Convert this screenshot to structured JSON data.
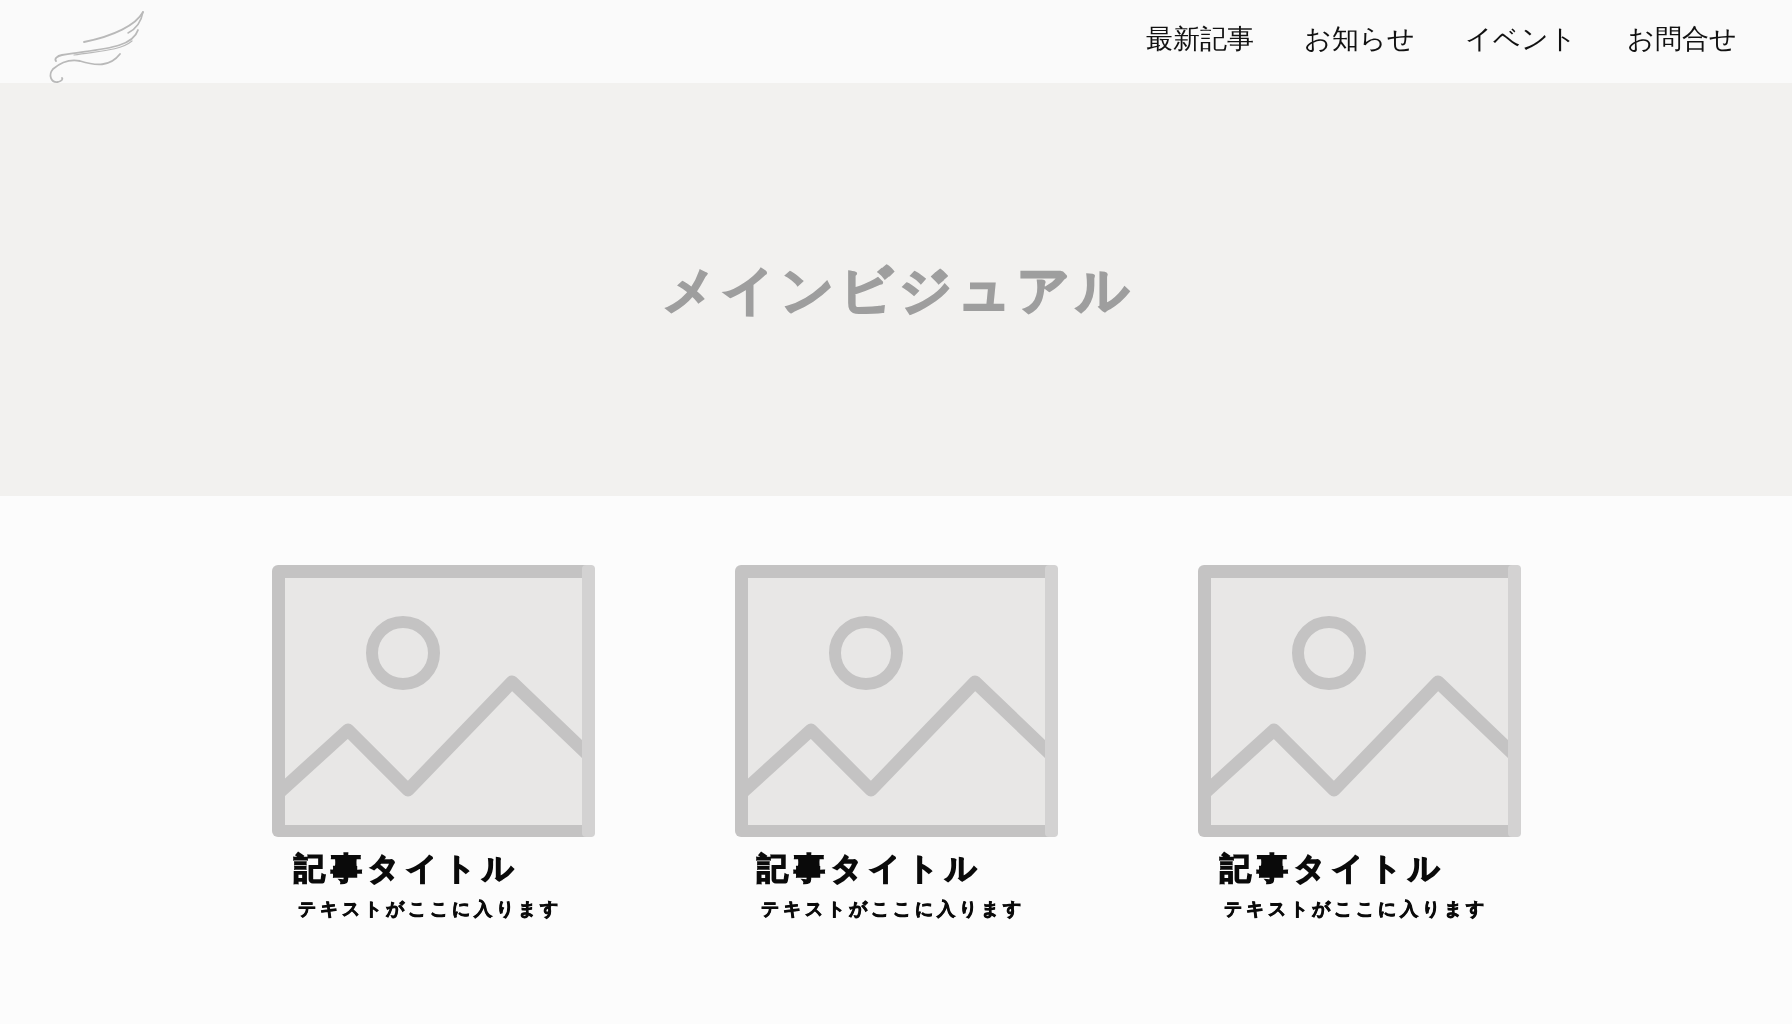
{
  "header": {
    "nav": [
      "最新記事",
      "お知らせ",
      "イベント",
      "お問合せ"
    ]
  },
  "hero": {
    "title": "メインビジュアル"
  },
  "articles": [
    {
      "title": "記事タイトル",
      "text": "テキストがここに入ります"
    },
    {
      "title": "記事タイトル",
      "text": "テキストがここに入ります"
    },
    {
      "title": "記事タイトル",
      "text": "テキストがここに入ります"
    }
  ]
}
